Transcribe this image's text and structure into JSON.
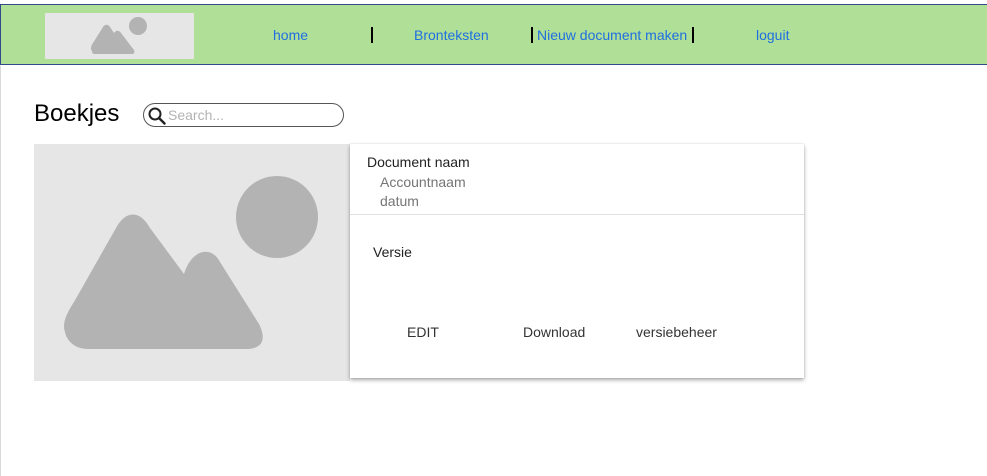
{
  "nav": {
    "links": [
      {
        "label": "home"
      },
      {
        "label": "Bronteksten"
      },
      {
        "label": "Nieuw document maken"
      },
      {
        "label": "loguit"
      }
    ]
  },
  "page": {
    "title": "Boekjes"
  },
  "search": {
    "placeholder": "Search..."
  },
  "card": {
    "document_name": "Document naam",
    "account_name": "Accountnaam",
    "date": "datum",
    "version_label": "Versie",
    "actions": {
      "edit": "EDIT",
      "download": "Download",
      "version_control": "versiebeheer"
    }
  },
  "colors": {
    "nav_background": "#b0df98",
    "nav_border": "#2f4b8a",
    "link": "#1f6fe0",
    "placeholder_bg": "#e6e6e6",
    "placeholder_shape": "#b3b3b3"
  }
}
